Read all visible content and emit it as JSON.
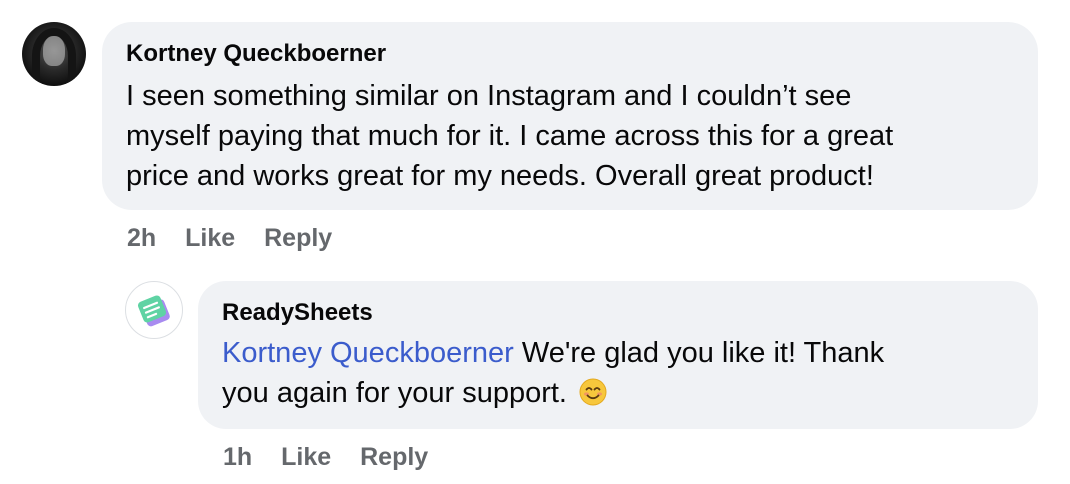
{
  "comment": {
    "author": "Kortney Queckboerner",
    "lines": [
      "I seen something similar on Instagram and I couldn’t see",
      "myself paying that much for it. I came across this for a great",
      "price and works great for my needs. Overall great product!"
    ],
    "time": "2h",
    "like_label": "Like",
    "reply_label": "Reply"
  },
  "reply": {
    "author": "ReadySheets",
    "mention": "Kortney Queckboerner",
    "line1_rest": "We're glad you like it! Thank",
    "line2": "you again for your support.",
    "emoji": "smiling-face-emoji",
    "time": "1h",
    "like_label": "Like",
    "reply_label": "Reply"
  },
  "colors": {
    "bubble": "#f0f2f5",
    "meta": "#65686c",
    "mention": "#3b5ccc",
    "logo_green": "#5fd3a4",
    "logo_purple": "#a88bf0"
  }
}
